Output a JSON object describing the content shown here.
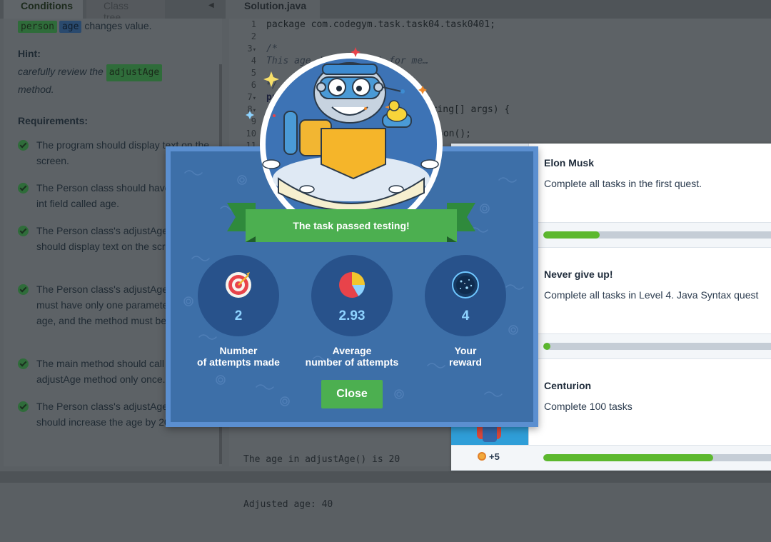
{
  "left_tabs": {
    "conditions": "Conditions",
    "class_tree": "Class tree",
    "collapse_icon": "triangle-left-icon"
  },
  "conditions": {
    "top_pill_1": "person",
    "top_pill_2": "age",
    "top_text": "changes value.",
    "hint_title": "Hint:",
    "hint_text_1": "carefully review the",
    "hint_pill": "adjustAge",
    "hint_text_2": "method.",
    "requirements_title": "Requirements:",
    "requirements": [
      "The program should display text on the screen.",
      "The Person class should have a public int field called age.",
      "The Person class's adjustAge method should display text on the screen.",
      "The Person class's adjustAge method must have only one parameter named age, and the method must be void.",
      "The main method should call the adjustAge method only once.",
      "The Person class's adjustAge method should increase the age by 20."
    ]
  },
  "editor": {
    "tab": "Solution.java",
    "line_numbers": [
      "1",
      "2",
      "3",
      "4",
      "5",
      "6",
      "7",
      "8",
      "9",
      "10",
      "11"
    ],
    "fold_markers": [
      "",
      "",
      "▾",
      "",
      "",
      "",
      "▾",
      "▾",
      "",
      "",
      ""
    ],
    "lines": [
      "package com.codegym.task.task04.task0401;",
      "",
      "/*",
      "This age doesn't work for me…",
      "",
      "*/",
      "public",
      "",
      "",
      "",
      ""
    ],
    "line_8_fragment": "String[] args) {",
    "line_10_fragment": "son();",
    "console": [
      "The age in adjustAge() is 20",
      "Adjusted age: 40"
    ]
  },
  "modal": {
    "banner": "The task passed testing!",
    "stats": [
      {
        "value": "2",
        "label_1": "Number",
        "label_2": "of attempts made",
        "icon": "target-icon"
      },
      {
        "value": "2.93",
        "label_1": "Average",
        "label_2": "number of attempts",
        "icon": "pie-chart-icon"
      },
      {
        "value": "4",
        "label_1": "Your",
        "label_2": "reward",
        "icon": "dark-matter-icon"
      }
    ],
    "close_label": "Close"
  },
  "achievements": [
    {
      "title": "Elon Musk",
      "description": "Complete all tasks in the first quest.",
      "progress": 0.24
    },
    {
      "title": "Never give up!",
      "description": "Complete all tasks in Level 4. Java Syntax quest",
      "progress": 0.03
    },
    {
      "title": "Centurion",
      "description": "Complete 100 tasks",
      "progress": 0.72,
      "reward": "+5",
      "reward_icon": "medal-icon"
    }
  ],
  "colors": {
    "modal_bg": "#3d6fa8",
    "banner_green": "#4caf50",
    "progress_green": "#5cb82e",
    "stat_value": "#8ed3ff"
  }
}
